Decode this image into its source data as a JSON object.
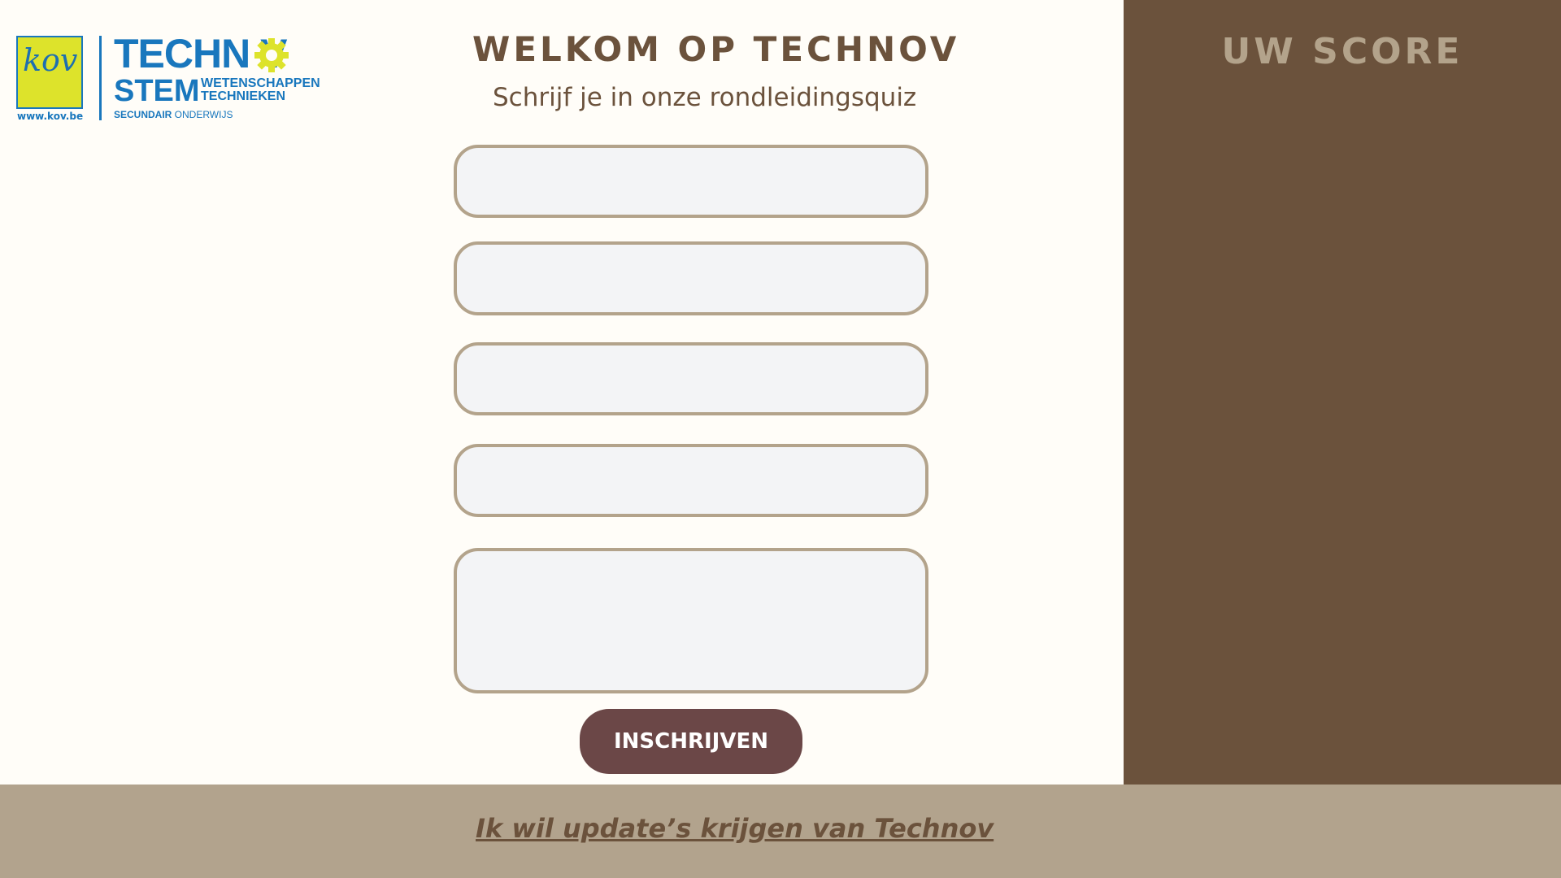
{
  "logo": {
    "kov_text": "kov",
    "url_text": "www.kov.be",
    "technov_text": "TECHN V",
    "stem_text": "STEM",
    "sub_line1": "WETENSCHAPPEN",
    "sub_line2": "TECHNIEKEN",
    "secundair_bold": "SECUNDAIR",
    "secundair_rest": " ONDERWIJS"
  },
  "header": {
    "title": "WELKOM OP TECHNOV",
    "subtitle": "Schrijf je in onze rondleidingsquiz"
  },
  "form": {
    "fields": [
      {
        "value": "",
        "placeholder": ""
      },
      {
        "value": "",
        "placeholder": ""
      },
      {
        "value": "",
        "placeholder": ""
      },
      {
        "value": "",
        "placeholder": ""
      },
      {
        "value": "",
        "placeholder": ""
      }
    ],
    "submit_label": "INSCHRIJVEN"
  },
  "score_panel": {
    "title": "UW SCORE"
  },
  "footer": {
    "link_text": "Ik wil update’s krijgen van Technov"
  },
  "colors": {
    "brown": "#6b523c",
    "taupe": "#b2a38d",
    "button": "#6b4747",
    "field_bg": "#f3f4f6",
    "logo_blue": "#1977bd",
    "logo_yellow": "#dde32b"
  }
}
